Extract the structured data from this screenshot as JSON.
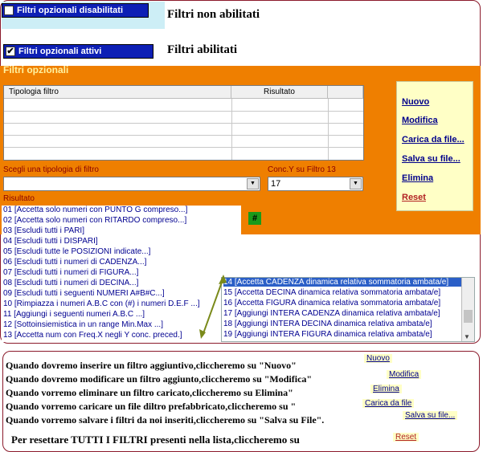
{
  "demo": {
    "disabled_checkbox_label": "Filtri opzionali disabilitati",
    "disabled_caption": "Filtri non abilitati",
    "enabled_checkbox_label": "Filtri opzionali attivi",
    "enabled_caption": "Filtri abilitati",
    "enabled_checked_mark": "✔"
  },
  "panel": {
    "title": "Filtri opzionali",
    "grid_headers": [
      "Tipologia filtro",
      "Risultato"
    ],
    "type_label": "Scegli una tipologia di filtro",
    "type_value": "",
    "conc_label": "Conc.Y su Filtro 13",
    "conc_value": "17",
    "result_label": "Risultato",
    "hash_label": "#"
  },
  "buttons": {
    "nuovo": "Nuovo",
    "modifica": "Modifica",
    "carica": "Carica da file...",
    "salva": "Salva su file...",
    "elimina": "Elimina",
    "reset": "Reset"
  },
  "list_left": [
    "01 [Accetta solo numeri con PUNTO G compreso...]",
    "02 [Accetta solo numeri con RITARDO compreso...]",
    "03 [Escludi tutti i PARI]",
    "04 [Escludi tutti i DISPARI]",
    "05 [Escludi tutte le POSIZIONI indicate...]",
    "06 [Escludi tutti i numeri di CADENZA...]",
    "07 [Escludi tutti i numeri di FIGURA...]",
    "08 [Escludi tutti i numeri di DECINA...]",
    "09 [Escludi tutti i seguenti NUMERI A#B#C...]",
    "10 [Rimpiazza i numeri A.B.C con (#) i numeri D.E.F ...]",
    "11 [Aggiungi i seguenti numeri A.B.C ...]",
    "12 [Sottoinsiemistica in un range Min.Max ...]",
    "13 [Accetta num con Freq.X negli Y conc. preced.]"
  ],
  "list_right": [
    "14 [Accetta CADENZA dinamica relativa sommatoria ambata/e]",
    "15 [Accetta DECINA dinamica relativa sommatoria ambata/e]",
    "16 [Accetta FIGURA dinamica relativa sommatoria ambata/e]",
    "17 [Aggiungi INTERA CADENZA dinamica relativa ambata/e]",
    "18 [Aggiungi INTERA DECINA dinamica relativa ambata/e]",
    "19 [Aggiungi INTERA FIGURA dinamica relativa ambata/e]"
  ],
  "instructions": [
    {
      "text": "Quando dovremo inserire un filtro aggiuntivo,cliccheremo su \"Nuovo\"",
      "chip": "Nuovo"
    },
    {
      "text": "Quando dovremo modificare un filtro aggiunto,cliccheremo su \"Modifica\"",
      "chip": "Modifica"
    },
    {
      "text": "Quando vorremo eliminare un filtro caricato,cliccheremo su Elimina\"",
      "chip": "Elimina"
    },
    {
      "text": "Quando vorremo caricare un file diltro prefabbricato,cliccheremo su \"",
      "chip": "Carica da file"
    },
    {
      "text": "Quando vorremo salvare i filtri da noi inseriti,cliccheremo su \"Salva su File\".",
      "chip": "Salva su file..."
    },
    {
      "text": "Per resettare TUTTI I FILTRI presenti nella lista,cliccheremo su",
      "chip": "Reset"
    }
  ],
  "colors": {
    "orange": "#ef7f00",
    "selection": "#2b5fc7",
    "arrow": "#7a8a1a"
  }
}
